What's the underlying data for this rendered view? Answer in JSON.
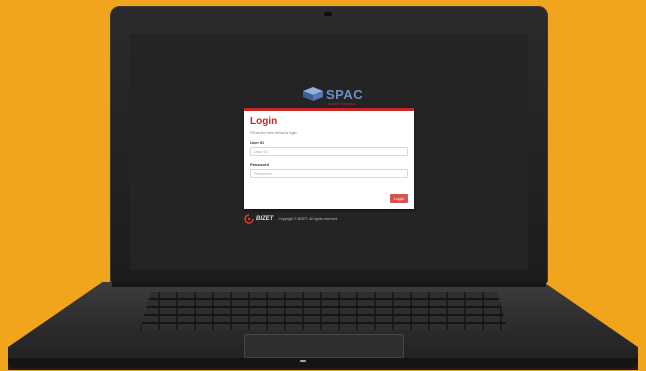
{
  "logo": {
    "text": "SPAC",
    "subtitle": "SMART PARKING"
  },
  "login": {
    "title": "Login",
    "subtitle": "Fill out the form below to login.",
    "user_id_label": "User ID",
    "user_id_placeholder": "User ID",
    "password_label": "Password",
    "password_placeholder": "Password",
    "login_button": "Login"
  },
  "footer": {
    "brand": "BIZET",
    "copyright": "Copyright © BIZET. All rights reserved."
  },
  "colors": {
    "background": "#F0A51C",
    "accent": "#c62828",
    "button": "#d9534f",
    "logo": "#6f8fbf"
  },
  "icons": [
    "logo-cube-icon",
    "brand-swirl-icon"
  ]
}
